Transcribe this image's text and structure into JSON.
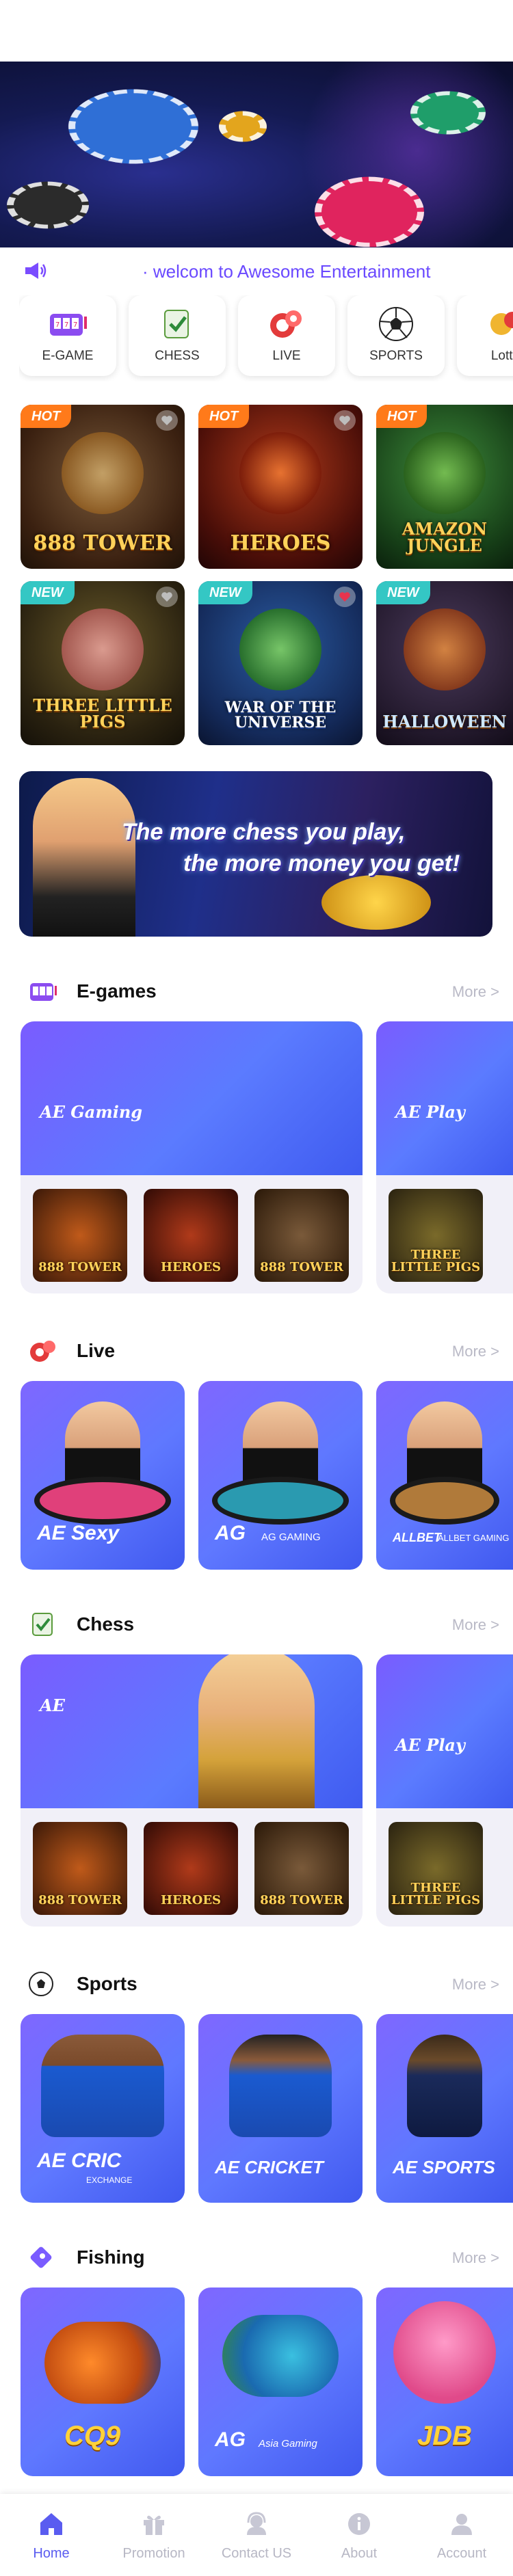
{
  "notice": {
    "text": "· welcom to Awesome Entertainment"
  },
  "categories": [
    {
      "label": "E-GAME",
      "icon": "slot-machine-icon"
    },
    {
      "label": "CHESS",
      "icon": "mahjong-icon"
    },
    {
      "label": "LIVE",
      "icon": "poker-chip-icon"
    },
    {
      "label": "SPORTS",
      "icon": "soccer-ball-icon"
    },
    {
      "label": "Lotte",
      "icon": "lottery-icon"
    }
  ],
  "featured_games": [
    {
      "badge": "HOT",
      "name": "888 TOWER",
      "favorite": false
    },
    {
      "badge": "HOT",
      "name": "HEROES",
      "favorite": false
    },
    {
      "badge": "HOT",
      "name": "AMAZON JUNGLE",
      "favorite": false
    },
    {
      "badge": "NEW",
      "name": "THREE LITTLE PIGS",
      "favorite": false
    },
    {
      "badge": "NEW",
      "name": "WAR OF THE UNIVERSE",
      "favorite": true
    },
    {
      "badge": "NEW",
      "name": "HALLOWEEN",
      "favorite": false
    }
  ],
  "promo_banner": {
    "line1": "The more chess you play,",
    "line2": "the more money you get!"
  },
  "sections": {
    "egames": {
      "title": "E-games",
      "more": "More >",
      "provider1": "AE Gaming",
      "provider2": "AE Play",
      "tiles": [
        "888 TOWER",
        "HEROES",
        "888 TOWER"
      ],
      "tiles2": [
        "THREE LITTLE PIGS"
      ]
    },
    "live": {
      "title": "Live",
      "more": "More >",
      "cards": [
        {
          "brand": "AE Sexy",
          "sub": ""
        },
        {
          "brand": "AG",
          "sub": "AG GAMING"
        },
        {
          "brand": "ALLBET",
          "sub": "ALLBET GAMING"
        }
      ]
    },
    "chess": {
      "title": "Chess",
      "more": "More >",
      "provider1": "AE",
      "provider2": "AE Play",
      "tiles": [
        "888 TOWER",
        "HEROES",
        "888 TOWER"
      ],
      "tiles2": [
        "THREE LITTLE PIGS"
      ]
    },
    "sports": {
      "title": "Sports",
      "more": "More >",
      "cards": [
        {
          "brand": "AE CRIC",
          "sub": "EXCHANGE"
        },
        {
          "brand": "AE CRICKET",
          "sub": ""
        },
        {
          "brand": "AE SPORTS",
          "sub": ""
        }
      ]
    },
    "fishing": {
      "title": "Fishing",
      "more": "More >",
      "cards": [
        {
          "brand": "CQ9",
          "sub": ""
        },
        {
          "brand": "AG",
          "sub": "Asia Gaming"
        },
        {
          "brand": "JDB",
          "sub": ""
        }
      ]
    }
  },
  "tabbar": [
    {
      "label": "Home",
      "icon": "home-icon",
      "active": true
    },
    {
      "label": "Promotion",
      "icon": "gift-icon",
      "active": false
    },
    {
      "label": "Contact US",
      "icon": "headset-icon",
      "active": false
    },
    {
      "label": "About",
      "icon": "info-icon",
      "active": false
    },
    {
      "label": "Account",
      "icon": "person-icon",
      "active": false
    }
  ],
  "colors": {
    "accent": "#5a5cf0",
    "notice_text": "#6a49ff",
    "hot_badge": "#ff7a1a",
    "new_badge": "#34c7c4"
  }
}
